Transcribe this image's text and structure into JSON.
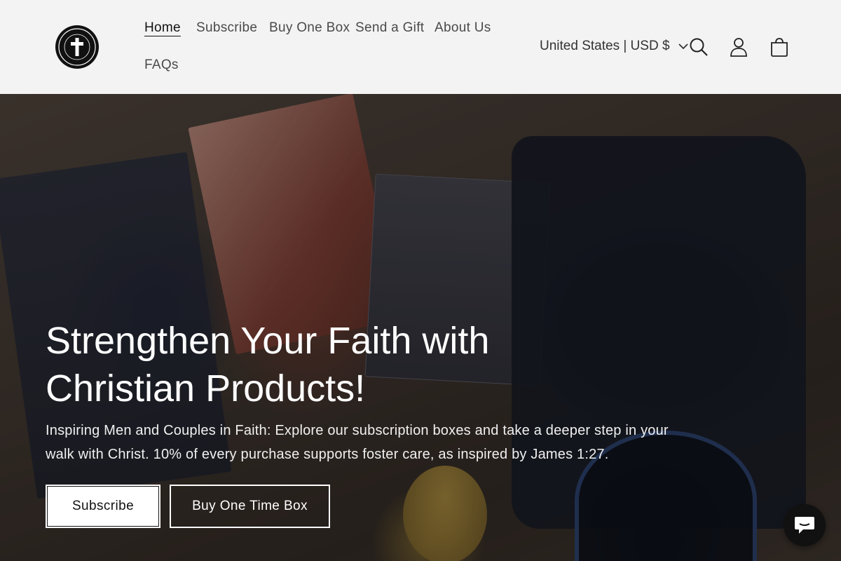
{
  "header": {
    "logo_alt": "The Iron & Light Co. Subscription Box",
    "nav": [
      {
        "label": "Home",
        "active": true
      },
      {
        "label": "Subscribe",
        "active": false
      },
      {
        "label": "Buy One Box",
        "active": false
      },
      {
        "label": "Send a Gift",
        "active": false
      },
      {
        "label": "About Us",
        "active": false
      },
      {
        "label": "FAQs",
        "active": false
      }
    ],
    "locale": "United States | USD $",
    "icons": [
      "search-icon",
      "account-icon",
      "cart-icon"
    ]
  },
  "hero": {
    "title": "Strengthen Your Faith with Christian Products!",
    "subtitle": "Inspiring Men and Couples in Faith: Explore our subscription boxes and take a deeper step in your walk with Christ. 10% of every purchase supports foster care, as inspired by James 1:27.",
    "buttons": {
      "primary": "Subscribe",
      "secondary": "Buy One Time Box"
    }
  },
  "chat": {
    "icon": "chat-icon"
  },
  "colors": {
    "header_bg": "#f3f3f3",
    "text": "#121212",
    "chat_bg": "#111111"
  }
}
